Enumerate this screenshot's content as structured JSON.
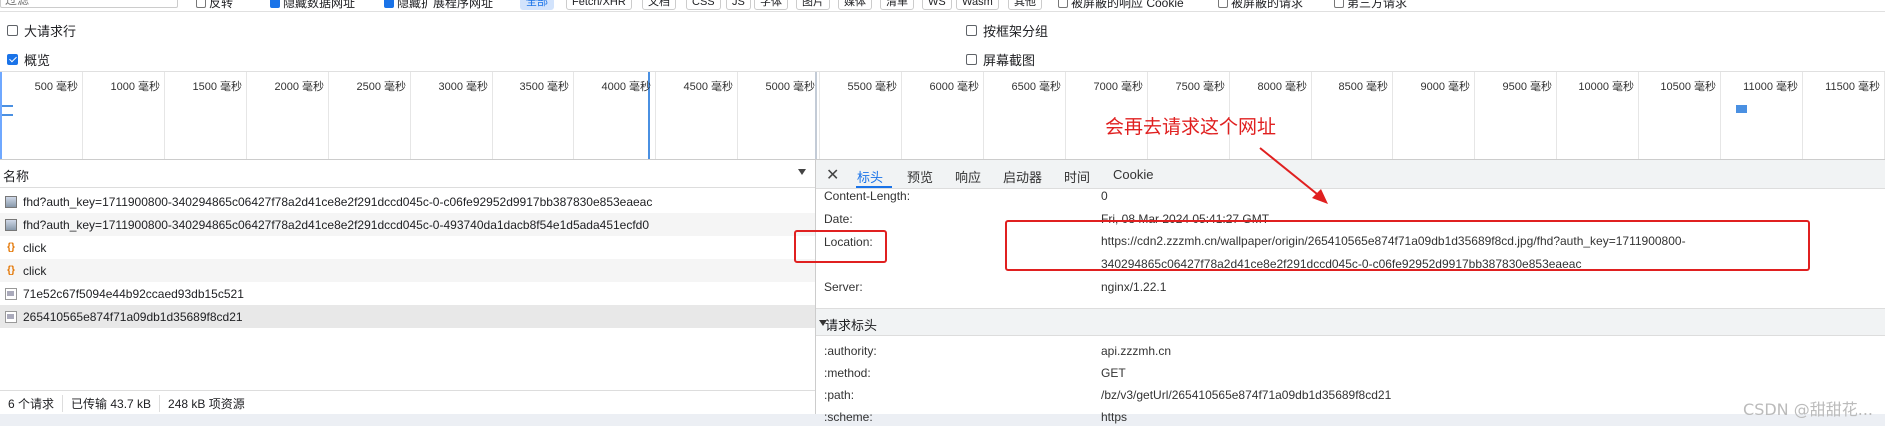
{
  "filter_bar": {
    "input_placeholder": "过滤",
    "invert_label": "反转",
    "hide_data_urls_label": "隐藏数据网址",
    "hide_extension_urls_label": "隐藏扩展程序网址",
    "type_chips": [
      "全部",
      "Fetch/XHR",
      "文档",
      "CSS",
      "JS",
      "字体",
      "图片",
      "媒体",
      "清单",
      "WS",
      "Wasm",
      "其他"
    ],
    "blocked_cookies_label": "被屏蔽的响应 Cookie",
    "blocked_requests_label": "被屏蔽的请求",
    "third_party_label": "第三方请求"
  },
  "options": {
    "large_rows": {
      "label": "大请求行",
      "checked": false
    },
    "overview": {
      "label": "概览",
      "checked": true
    },
    "group_by_frame": {
      "label": "按框架分组",
      "checked": false
    },
    "screenshots": {
      "label": "屏幕截图",
      "checked": false
    }
  },
  "overview": {
    "ticks": [
      "500 毫秒",
      "1000 毫秒",
      "1500 毫秒",
      "2000 毫秒",
      "2500 毫秒",
      "3000 毫秒",
      "3500 毫秒",
      "4000 毫秒",
      "4500 毫秒",
      "5000 毫秒",
      "5500 毫秒",
      "6000 毫秒",
      "6500 毫秒",
      "7000 毫秒",
      "7500 毫秒",
      "8000 毫秒",
      "8500 毫秒",
      "9000 毫秒",
      "9500 毫秒",
      "10000 毫秒",
      "10500 毫秒",
      "11000 毫秒",
      "11500 毫秒"
    ]
  },
  "request_list": {
    "column_name": "名称",
    "rows": [
      {
        "icon": "image-icon",
        "name": "fhd?auth_key=1711900800-340294865c06427f78a2d41ce8e2f291dccd045c-0-c06fe92952d9917bb387830e853eaeac"
      },
      {
        "icon": "image-icon",
        "name": "fhd?auth_key=1711900800-340294865c06427f78a2d41ce8e2f291dccd045c-0-493740da1dacb8f54e1d5ada451ecfd0"
      },
      {
        "icon": "xhr-icon",
        "name": "click"
      },
      {
        "icon": "xhr-icon",
        "name": "click"
      },
      {
        "icon": "document-icon",
        "name": "71e52c67f5094e44b92ccaed93db15c521"
      },
      {
        "icon": "document-icon",
        "name": "265410565e874f71a09db1d35689f8cd21"
      }
    ]
  },
  "status_bar": {
    "requests": "6 个请求",
    "transferred": "已传输 43.7 kB",
    "resources": "248 kB 项资源"
  },
  "detail": {
    "tabs": [
      "标头",
      "预览",
      "响应",
      "启动器",
      "时间",
      "Cookie"
    ],
    "response_headers": [
      {
        "name": "Content-Length:",
        "value": "0"
      },
      {
        "name": "Date:",
        "value": "Fri, 08 Mar 2024 05:41:27 GMT"
      },
      {
        "name": "Location:",
        "value": "https://cdn2.zzzmh.cn/wallpaper/origin/265410565e874f71a09db1d35689f8cd.jpg/fhd?auth_key=1711900800-",
        "value_line2": "340294865c06427f78a2d41ce8e2f291dccd045c-0-c06fe92952d9917bb387830e853eaeac"
      },
      {
        "name": "Server:",
        "value": "nginx/1.22.1"
      }
    ],
    "request_section_title": "请求标头",
    "request_headers": [
      {
        "name": ":authority:",
        "value": "api.zzzmh.cn"
      },
      {
        "name": ":method:",
        "value": "GET"
      },
      {
        "name": ":path:",
        "value": "/bz/v3/getUrl/265410565e874f71a09db1d35689f8cd21"
      },
      {
        "name": ":scheme:",
        "value": "https"
      }
    ]
  },
  "annotation": {
    "text": "会再去请求这个网址",
    "color": "#e02020"
  },
  "watermark": "CSDN @甜甜花..."
}
